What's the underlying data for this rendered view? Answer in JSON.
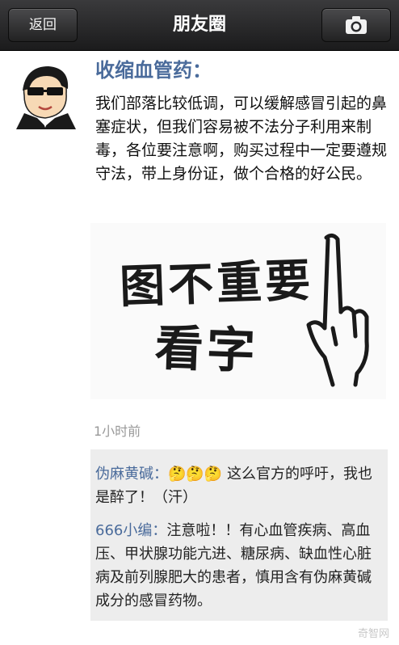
{
  "header": {
    "back_label": "返回",
    "title": "朋友圈"
  },
  "post": {
    "author": "收缩血管药：",
    "text": "我们部落比较低调，可以缓解感冒引起的鼻塞症状，但我们容易被不法分子利用来制毒，各位要注意啊，购买过程中一定要遵规守法，带上身份证，做个合格的好公民。",
    "image_text_line1": "图不重要",
    "image_text_line2": "看字",
    "timestamp": "1小时前"
  },
  "comments": [
    {
      "user": "伪麻黄碱：",
      "emojis": "🤔🤔🤔",
      "text": " 这么官方的呼吁，我也是醉了！（汗）"
    },
    {
      "user": "666小编：",
      "text": "注意啦！！有心血管疾病、高血压、甲状腺功能亢进、糖尿病、缺血性心脏病及前列腺肥大的患者，慎用含有伪麻黄碱成分的感冒药物。"
    }
  ],
  "watermark": "奇智网",
  "icons": {
    "camera": "camera-icon",
    "avatar": "cartoon-avatar"
  },
  "colors": {
    "header_bg": "#2a2a2c",
    "link_blue": "#4a6b9b",
    "comment_bg": "#ededed"
  }
}
